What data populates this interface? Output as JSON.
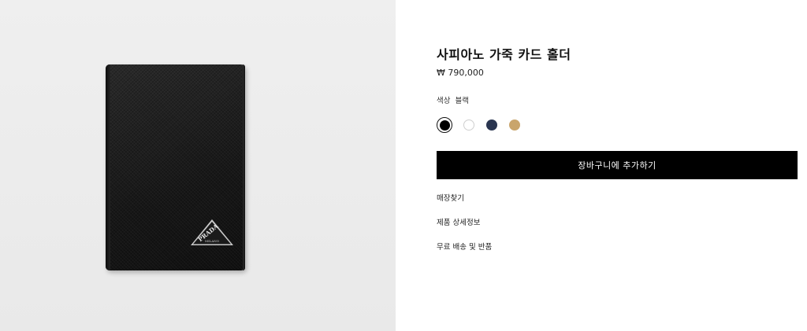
{
  "product": {
    "title": "사피아노 가죽 카드 홀더",
    "price": "₩ 790,000",
    "color_label": "색상",
    "color_value": "블랙",
    "swatches": [
      {
        "name": "black",
        "color": "#000000",
        "selected": true
      },
      {
        "name": "white",
        "color": "#ffffff",
        "selected": false
      },
      {
        "name": "navy",
        "color": "#2a3550",
        "selected": false
      },
      {
        "name": "beige",
        "color": "#c9a56c",
        "selected": false
      }
    ],
    "image_logo_text": "PRADA"
  },
  "actions": {
    "add_to_cart": "장바구니에 추가하기"
  },
  "links": {
    "store_finder": "매장찾기",
    "product_details": "제품 상세정보",
    "shipping_returns": "무료 배송 및 반품"
  }
}
